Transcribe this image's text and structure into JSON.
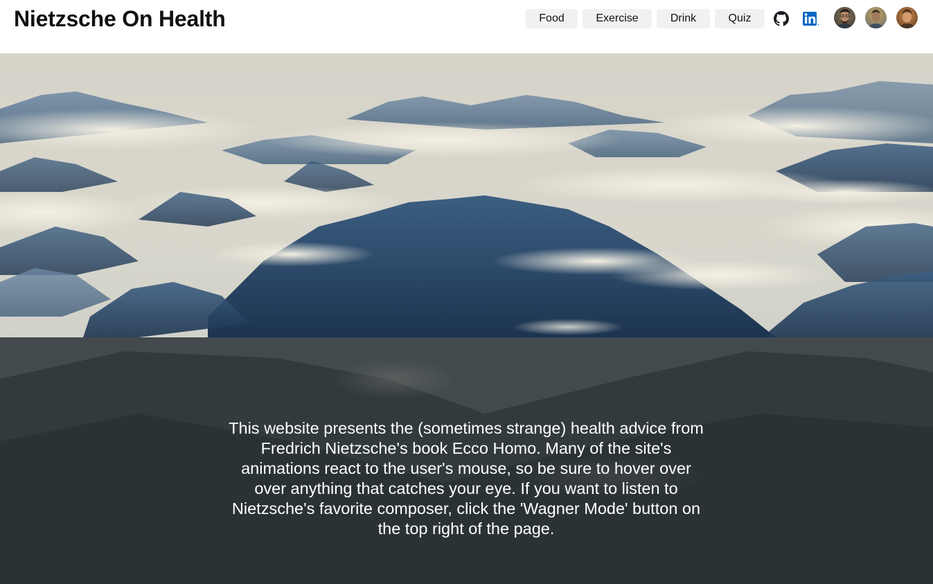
{
  "header": {
    "title": "Nietzsche On Health"
  },
  "nav": {
    "items": [
      {
        "label": "Food"
      },
      {
        "label": "Exercise"
      },
      {
        "label": "Drink"
      },
      {
        "label": "Quiz"
      }
    ],
    "icons": [
      "github-icon",
      "linkedin-icon"
    ],
    "avatars": [
      "avatar-1",
      "avatar-2",
      "avatar-3"
    ]
  },
  "hero": {
    "intro_text": "This website presents the (sometimes strange) health advice from Fredrich Nietzsche's book Ecco Homo. Many of the site's animations react to the user's mouse, so be sure to hover over over anything that catches your eye. If you want to listen to Nietzsche's favorite composer, click the 'Wagner Mode' button on the top right of the page."
  },
  "colors": {
    "linkedin": "#0a66c2",
    "nav_button_bg": "#f1f1f1",
    "overlay": "#1e2224",
    "mountain": "#2c4b68"
  }
}
